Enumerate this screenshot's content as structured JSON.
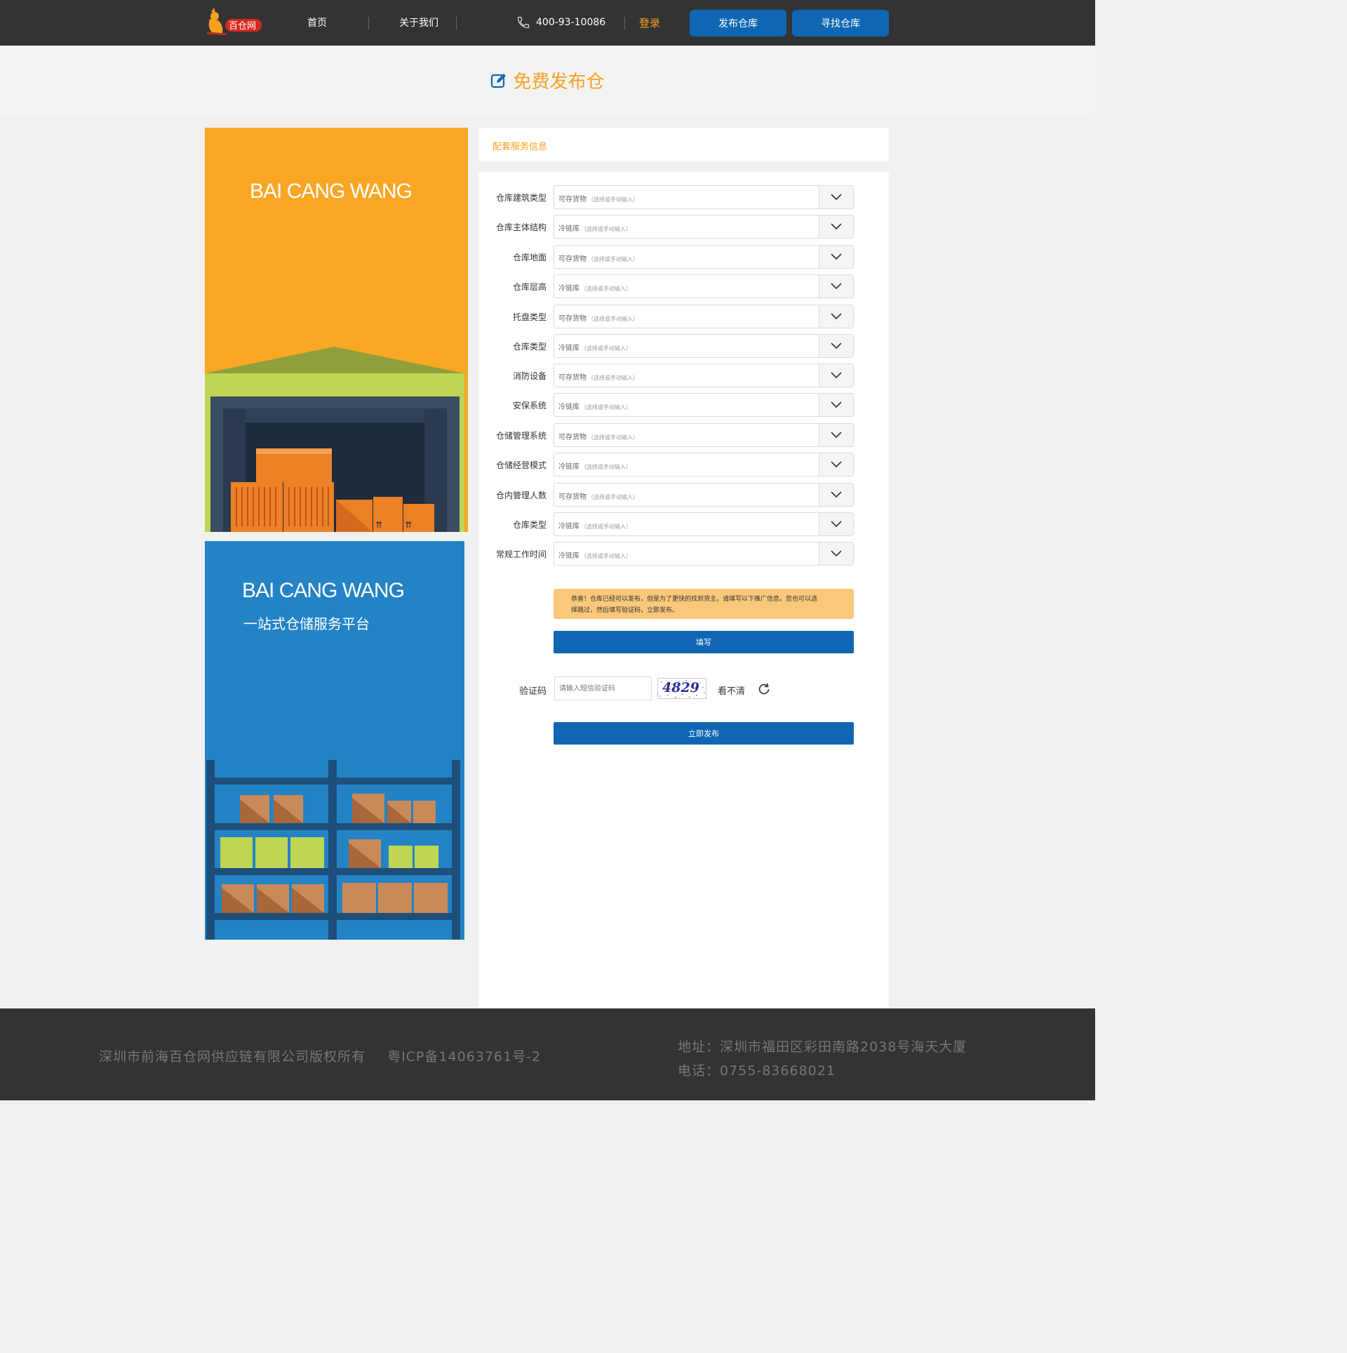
{
  "header": {
    "logo_text": "百仓网",
    "nav": [
      "首页",
      "关于我们"
    ],
    "phone": "400-93-10086",
    "login": "登录",
    "publish_btn": "发布仓库",
    "find_btn": "寻找仓库"
  },
  "banner": {
    "title": "免费发布仓"
  },
  "art": {
    "top_title": "BAI CANG WANG",
    "bottom_title": "BAI CANG WANG",
    "bottom_subtitle": "一站式仓储服务平台"
  },
  "panel": {
    "section_title": "配套服务信息",
    "fields": [
      {
        "label": "仓库建筑类型",
        "value": "可存货物",
        "hint": "（选择或手动输入）"
      },
      {
        "label": "仓库主体结构",
        "value": "冷链库",
        "hint": "（选择或手动输入）"
      },
      {
        "label": "仓库地面",
        "value": "可存货物",
        "hint": "（选择或手动输入）"
      },
      {
        "label": "仓库层高",
        "value": "冷链库",
        "hint": "（选择或手动输入）"
      },
      {
        "label": "托盘类型",
        "value": "可存货物",
        "hint": "（选择或手动输入）"
      },
      {
        "label": "仓库类型",
        "value": "冷链库",
        "hint": "（选择或手动输入）"
      },
      {
        "label": "消防设备",
        "value": "可存货物",
        "hint": "（选择或手动输入）"
      },
      {
        "label": "安保系统",
        "value": "冷链库",
        "hint": "（选择或手动输入）"
      },
      {
        "label": "仓储管理系统",
        "value": "可存货物",
        "hint": "（选择或手动输入）"
      },
      {
        "label": "仓储经营模式",
        "value": "冷链库",
        "hint": "（选择或手动输入）"
      },
      {
        "label": "仓内管理人数",
        "value": "可存货物",
        "hint": "（选择或手动输入）"
      },
      {
        "label": "仓库类型",
        "value": "冷链库",
        "hint": "（选择或手动输入）"
      },
      {
        "label": "常规工作时间",
        "value": "冷链库",
        "hint": "（选择或手动输入）"
      }
    ],
    "notice_line1": "恭喜！仓库已经可以发布，但是为了更快的找到货主，请填写以下推广信息。您也可以选",
    "notice_line2": "择跳过，然后填写验证码，立即发布。",
    "fill_btn": "填写",
    "verify_label": "验证码",
    "verify_placeholder": "请输入短信验证码",
    "captcha": "4829",
    "unclear": "看不清",
    "submit_btn": "立即发布"
  },
  "footer": {
    "company": "深圳市前海百仓网供应链有限公司版权所有",
    "icp": "粤ICP备14063761号-2",
    "address": "地址：深圳市福田区彩田南路2038号海天大厦",
    "phone": "电话：0755-83668021"
  },
  "colors": {
    "header_bg": "#333333",
    "accent_orange": "#f7a120",
    "primary_blue": "#0f67b3",
    "art_orange": "#f9a725",
    "art_blue": "#2383c5",
    "notice_bg": "#f9c87a"
  }
}
